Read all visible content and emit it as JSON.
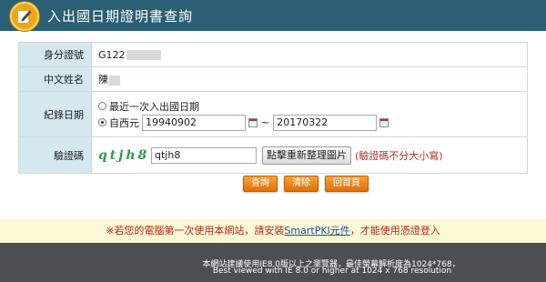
{
  "header": {
    "title": "入出國日期證明書查詢",
    "icon": "edit-pencil-icon",
    "bg_color": "#2a5f74"
  },
  "form": {
    "id_label": "身分證號",
    "id_value": "G122",
    "name_label": "中文姓名",
    "name_value": "陳",
    "date_label": "紀錄日期",
    "option_recent": "最近一次入出國日期",
    "option_since": "自西元",
    "date_from": "19940902",
    "date_separator": "~",
    "date_to": "20170322",
    "captcha_label": "驗證碼",
    "captcha_image_text": "qtjh8",
    "captcha_input": "qtjh8",
    "refresh_button": "點擊重新整理圖片",
    "captcha_note": "(驗證碼不分大小寫)"
  },
  "buttons": {
    "query": "查詢",
    "clear": "清除",
    "home": "回首頁",
    "color": "#e8800f"
  },
  "notice": {
    "prefix": "※若您的電腦第一次使用本網站，請安裝",
    "link": "SmartPKI元件",
    "suffix": "，才能使用憑證登入"
  },
  "footer": {
    "line1": "本網站建議使用IE8.0版以上之瀏覽器，最佳螢幕解析度為1024*768，",
    "line2": "Best viewed with IE 8.0 or higher at 1024 x 768 resolution"
  }
}
